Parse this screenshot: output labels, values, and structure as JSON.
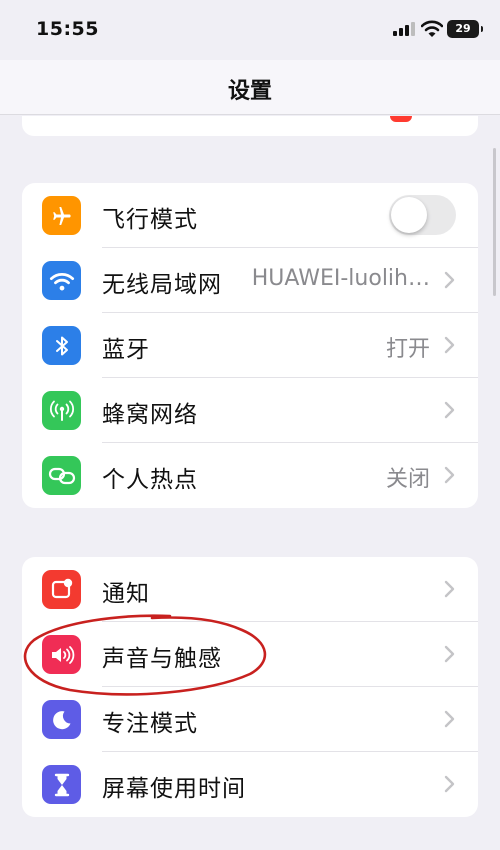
{
  "status_bar": {
    "time": "15:55",
    "battery_level": "29",
    "icons": [
      "cellular-signal-icon",
      "wifi-icon",
      "battery-icon"
    ]
  },
  "nav": {
    "title": "设置"
  },
  "groups": [
    {
      "items": [
        {
          "label": "飞行模式",
          "icon": "airplane-icon",
          "icon_color": "#ff9500",
          "control": "toggle",
          "toggle_on": false
        },
        {
          "label": "无线局域网",
          "icon": "wifi-icon",
          "icon_color": "#2c7fe8",
          "value": "HUAWEI-luolih…",
          "control": "chevron"
        },
        {
          "label": "蓝牙",
          "icon": "bluetooth-icon",
          "icon_color": "#2c7fe8",
          "value": "打开",
          "control": "chevron"
        },
        {
          "label": "蜂窝网络",
          "icon": "antenna-icon",
          "icon_color": "#34c759",
          "control": "chevron"
        },
        {
          "label": "个人热点",
          "icon": "hotspot-link-icon",
          "icon_color": "#34c759",
          "value": "关闭",
          "control": "chevron"
        }
      ]
    },
    {
      "items": [
        {
          "label": "通知",
          "icon": "notification-bell-icon",
          "icon_color": "#f33a30",
          "control": "chevron"
        },
        {
          "label": "声音与触感",
          "icon": "speaker-icon",
          "icon_color": "#f02d55",
          "control": "chevron"
        },
        {
          "label": "专注模式",
          "icon": "moon-icon",
          "icon_color": "#5e5ce6",
          "control": "chevron"
        },
        {
          "label": "屏幕使用时间",
          "icon": "hourglass-icon",
          "icon_color": "#5e5ce6",
          "control": "chevron"
        }
      ]
    }
  ],
  "annotation": {
    "highlighted_item": "声音与触感",
    "color": "#c8211f"
  }
}
